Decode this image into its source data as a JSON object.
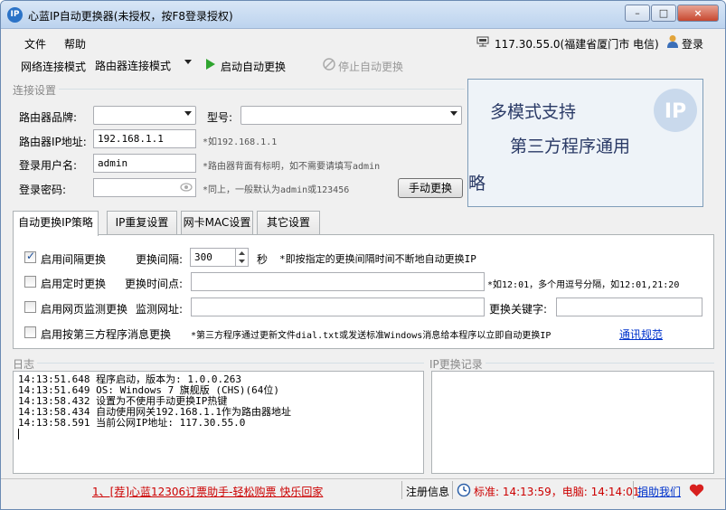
{
  "window": {
    "title": "心蓝IP自动更换器(未授权，按F8登录授权)",
    "icon_text": "IP",
    "buttons": {
      "minimize": "–",
      "maximize": "□",
      "close": "×"
    }
  },
  "menu": {
    "file": "文件",
    "help": "帮助",
    "ip_status": "117.30.55.0(福建省厦门市 电信)",
    "login": "登录"
  },
  "toolbar": {
    "mode_label": "网络连接模式",
    "mode_value": "路由器连接模式",
    "start_label": "启动自动更换",
    "stop_label": "停止自动更换"
  },
  "connection": {
    "group_label": "连接设置",
    "brand_label": "路由器品牌:",
    "brand_value": "",
    "model_label": "型号:",
    "model_value": "",
    "ip_label": "路由器IP地址:",
    "ip_value": "192.168.1.1",
    "ip_hint": "*如192.168.1.1",
    "user_label": "登录用户名:",
    "user_value": "admin",
    "user_hint": "*路由器背面有标明，如不需要请填写admin",
    "pass_label": "登录密码:",
    "pass_value": "",
    "pass_hint": "*同上，一般默认为admin或123456",
    "manual_button": "手动更换"
  },
  "banner": {
    "line1": "多模式支持",
    "line2": "第三方程序通用",
    "line3": "略",
    "logo_text": "IP"
  },
  "tabs": [
    {
      "label": "自动更换IP策略"
    },
    {
      "label": "IP重复设置"
    },
    {
      "label": "网卡MAC设置"
    },
    {
      "label": "其它设置"
    }
  ],
  "strategy": {
    "interval": {
      "label": "启用间隔更换",
      "checked": true,
      "field_label": "更换间隔:",
      "value": "300",
      "unit": "秒",
      "hint": "*即按指定的更换间隔时间不断地自动更换IP"
    },
    "timed": {
      "label": "启用定时更换",
      "checked": false,
      "field_label": "更换时间点:",
      "value": "",
      "hint": "*如12:01，多个用逗号分隔，如12:01,21:20"
    },
    "web": {
      "label": "启用网页监测更换",
      "checked": false,
      "field_label": "监测网址:",
      "value": "",
      "keyword_label": "更换关键字:",
      "keyword_value": ""
    },
    "third": {
      "label": "启用按第三方程序消息更换",
      "checked": false,
      "hint": "*第三方程序通过更新文件dial.txt或发送标准Windows消息给本程序以立即自动更换IP",
      "link": "通讯规范"
    }
  },
  "log": {
    "label": "日志",
    "lines": [
      "14:13:51.648 程序启动，版本为: 1.0.0.263",
      "14:13:51.649 OS: Windows 7 旗舰版 (CHS)(64位)",
      "14:13:58.432 设置为不使用手动更换IP热键",
      "14:13:58.434 自动使用网关192.168.1.1作为路由器地址",
      "14:13:58.591 当前公网IP地址: 117.30.55.0"
    ]
  },
  "ip_history": {
    "label": "IP更换记录"
  },
  "status": {
    "ad_link": "1、[荐]心蓝12306订票助手-轻松购票 快乐回家",
    "register": "注册信息",
    "time_text": "标准: 14:13:59，电脑: 14:14:01",
    "donate": "捐助我们"
  },
  "colors": {
    "accent": "#2b73c7",
    "start_green": "#2fa52f",
    "ad_red": "#cc0000",
    "link_blue": "#0033cc"
  }
}
